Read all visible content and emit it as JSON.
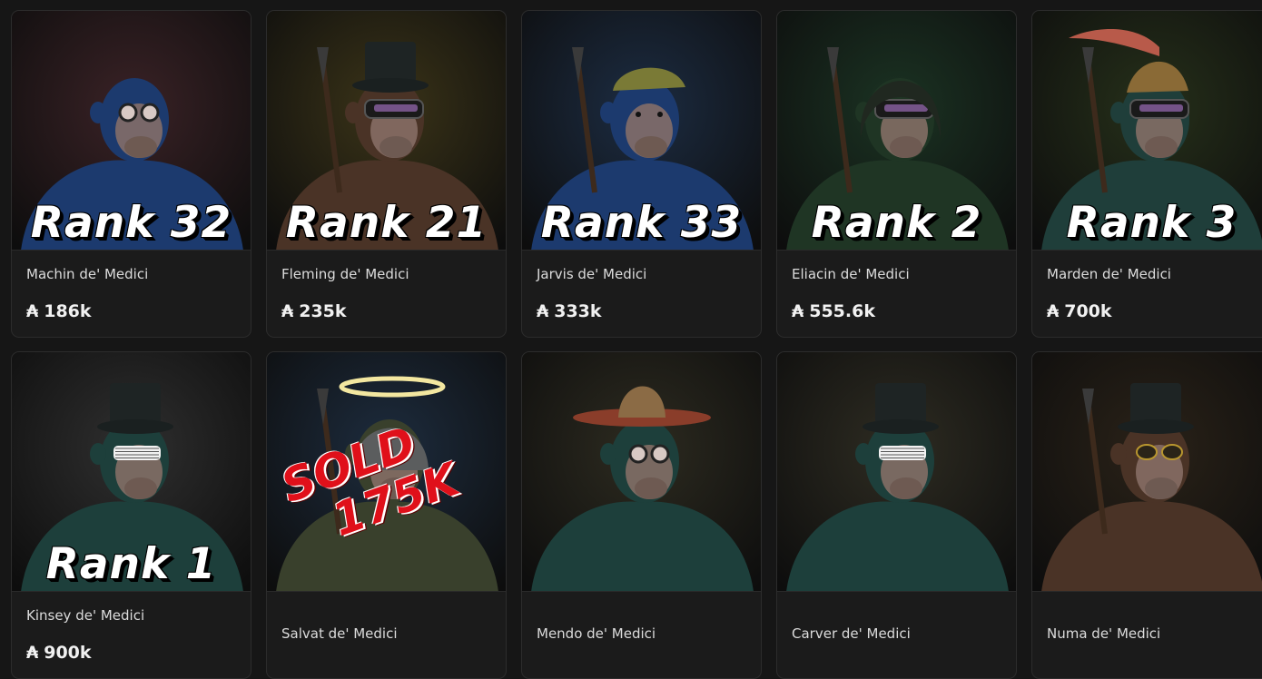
{
  "currency_symbol": "₳",
  "sold_overlay": {
    "line1": "SOLD",
    "line2": "175K"
  },
  "cards": [
    {
      "name": "Machin de' Medici",
      "rank": "Rank 32",
      "price": "186k",
      "bg": "#3a2226",
      "fur": "#1c3a6e",
      "hat": "none",
      "eyewear": "goggles"
    },
    {
      "name": "Fleming de' Medici",
      "rank": "Rank 21",
      "price": "235k",
      "bg": "#3b3418",
      "fur": "#4a3326",
      "hat": "tophat",
      "eyewear": "visor"
    },
    {
      "name": "Jarvis de' Medici",
      "rank": "Rank 33",
      "price": "333k",
      "bg": "#1c2c42",
      "fur": "#1c3a6e",
      "hat": "flatcap",
      "eyewear": "none"
    },
    {
      "name": "Eliacin de' Medici",
      "rank": "Rank 2",
      "price": "555.6k",
      "bg": "#1b3323",
      "fur": "#1f3524",
      "hat": "hood",
      "eyewear": "visor"
    },
    {
      "name": "Marden de' Medici",
      "rank": "Rank 3",
      "price": "700k",
      "bg": "#26301a",
      "fur": "#1f3e3a",
      "hat": "feather",
      "eyewear": "visor"
    },
    {
      "name": "Kinsey de' Medici",
      "rank": "Rank 1",
      "price": "900k",
      "bg": "#2f2f2f",
      "fur": "#1d3f3b",
      "hat": "tophat",
      "eyewear": "shutter"
    },
    {
      "name": "Salvat de' Medici",
      "rank": "",
      "price": "",
      "bg": "#1d2c3e",
      "fur": "#39402c",
      "hat": "helmet",
      "eyewear": "none",
      "sold": true
    },
    {
      "name": "Mendo de' Medici",
      "rank": "",
      "price": "",
      "bg": "#2d2b20",
      "fur": "#1d3f3b",
      "hat": "sombrero",
      "eyewear": "goggles"
    },
    {
      "name": "Carver de' Medici",
      "rank": "",
      "price": "",
      "bg": "#2e2c22",
      "fur": "#1d3f3b",
      "hat": "tophat",
      "eyewear": "shutter"
    },
    {
      "name": "Numa de' Medici",
      "rank": "",
      "price": "",
      "bg": "#2a2218",
      "fur": "#4a3326",
      "hat": "tophat",
      "eyewear": "sunglasses"
    }
  ]
}
